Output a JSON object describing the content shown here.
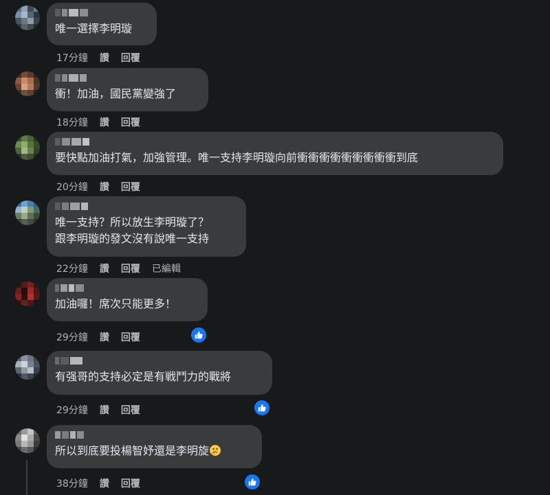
{
  "actions": {
    "like": "讚",
    "reply": "回覆",
    "edited": "已編輯"
  },
  "comments": [
    {
      "time": "17分鐘",
      "text": "唯一選擇李明璇",
      "liked": false,
      "edited": false
    },
    {
      "time": "18分鐘",
      "text": "衝！加油，國民黨變強了",
      "liked": false,
      "edited": false
    },
    {
      "time": "20分鐘",
      "text": "要快點加油打氣，加強管理。唯一支持李明璇向前衝衝衝衝衝衝衝衝衝到底",
      "liked": false,
      "edited": false
    },
    {
      "time": "22分鐘",
      "text": "唯一支持？所以放生李明璇了？\n跟李明璇的發文沒有說唯一支持",
      "liked": false,
      "edited": true
    },
    {
      "time": "29分鐘",
      "text": "加油囉！席次只能更多！",
      "liked": true,
      "edited": false
    },
    {
      "time": "29分鐘",
      "text": "有强哥的支持必定是有戦鬥力的戰將",
      "liked": true,
      "edited": false
    },
    {
      "time": "38分鐘",
      "text": "所以到底要投楊智妤還是李明旋",
      "liked": true,
      "edited": false,
      "emoji": "thinking-face-emoji"
    }
  ],
  "colors": {
    "background": "#18191a",
    "bubble": "#3a3b3c",
    "text": "#e4e6eb",
    "meta": "#b0b3b8",
    "like_blue": "#1877f2"
  }
}
